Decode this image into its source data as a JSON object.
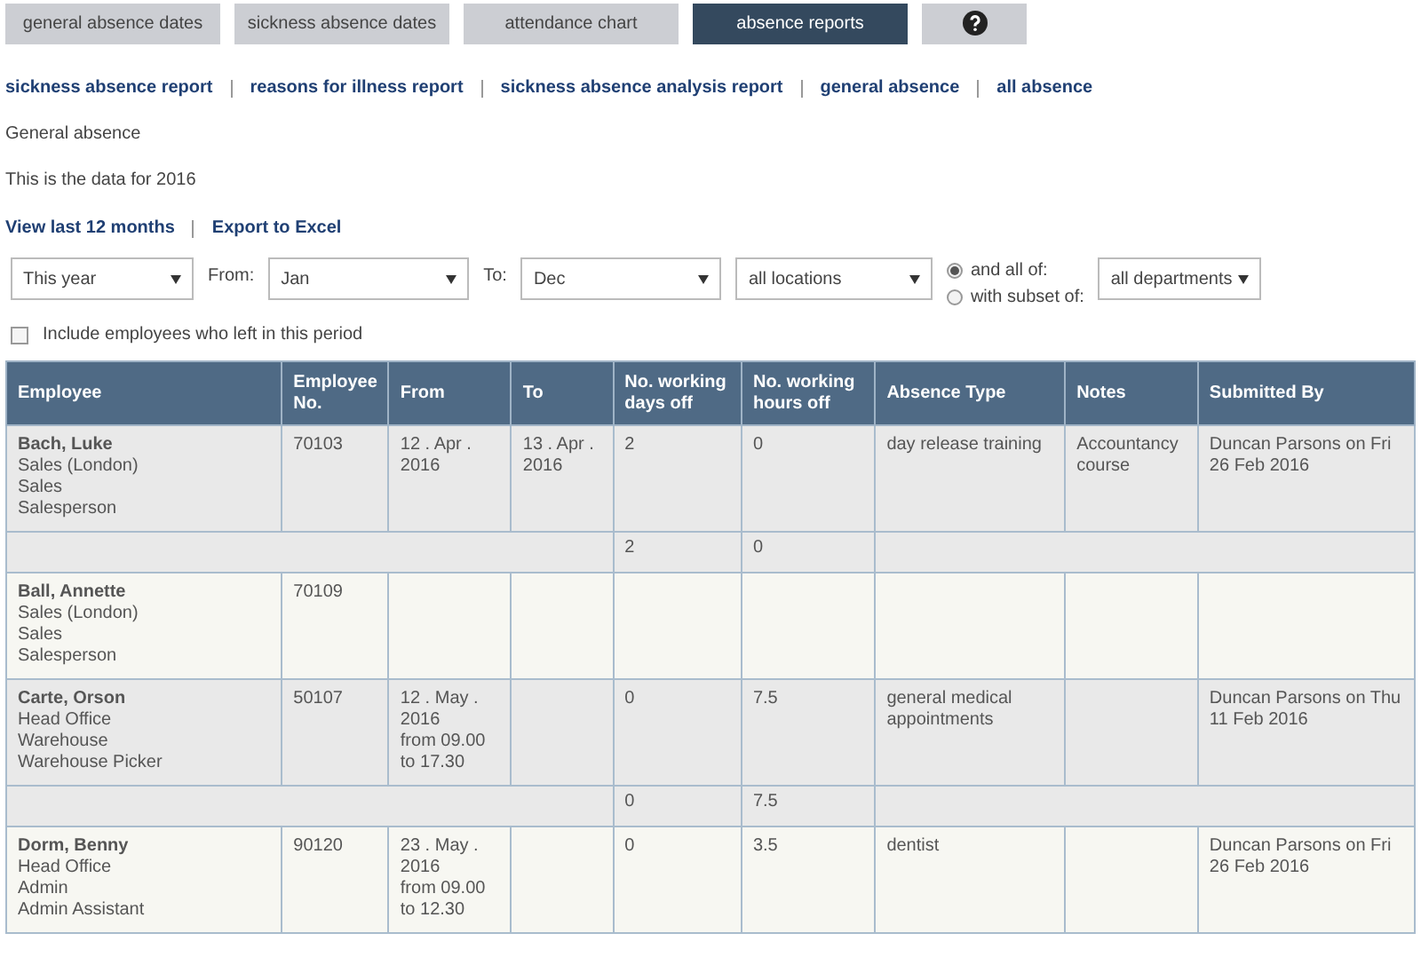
{
  "tabs": [
    {
      "kind": "text",
      "label": "general absence dates",
      "selected": false
    },
    {
      "kind": "text",
      "label": "sickness absence dates",
      "selected": false
    },
    {
      "kind": "text",
      "label": "attendance chart",
      "selected": false
    },
    {
      "kind": "text",
      "label": "absence reports",
      "selected": true
    },
    {
      "kind": "help",
      "selected": false
    }
  ],
  "report_links": [
    "sickness absence report",
    "reasons for illness report",
    "sickness absence analysis report",
    "general absence",
    "all absence"
  ],
  "report_title": "General absence",
  "subtitle": "This is the data for 2016",
  "actions": [
    "View last 12 months",
    "Export to Excel"
  ],
  "filters": {
    "period": "This year",
    "from_label": "From:",
    "from": "Jan",
    "to_label": "To:",
    "to": "Dec",
    "location": "all locations",
    "radios": [
      {
        "label": "and all of:",
        "selected": true
      },
      {
        "label": "with subset of:",
        "selected": false
      }
    ],
    "department": "all departments",
    "leavers": {
      "label": "Include employees who left in this period",
      "checked": false
    }
  },
  "table": {
    "columns": [
      "Employee",
      "Employee No.",
      "From",
      "To",
      "No. working days off",
      "No. working hours off",
      "Absence Type",
      "Notes",
      "Submitted By"
    ],
    "rows": [
      {
        "kind": "employee",
        "name": "Bach, Luke",
        "details": [
          "Sales (London)",
          "Sales",
          "Salesperson"
        ],
        "employee_no": "70103",
        "from": [
          "12 . Apr .",
          "2016"
        ],
        "to": [
          "13 . Apr .",
          "2016"
        ],
        "days": "2",
        "hours": "0",
        "absence_type": "day release training",
        "notes": "Accountancy course",
        "submitted_by": "Duncan Parsons on Fri 26 Feb 2016"
      },
      {
        "kind": "subtotal",
        "days": "2",
        "hours": "0"
      },
      {
        "kind": "employee",
        "name": "Ball, Annette",
        "details": [
          "Sales (London)",
          "Sales",
          "Salesperson"
        ],
        "employee_no": "70109"
      },
      {
        "kind": "employee",
        "name": "Carte, Orson",
        "details": [
          "Head Office",
          "Warehouse",
          "Warehouse Picker"
        ],
        "employee_no": "50107",
        "from": [
          "12 . May .",
          "2016",
          "from 09.00",
          "to 17.30"
        ],
        "days": "0",
        "hours": "7.5",
        "absence_type": "general medical appointments",
        "submitted_by": "Duncan Parsons on Thu 11 Feb 2016"
      },
      {
        "kind": "subtotal",
        "days": "0",
        "hours": "7.5"
      },
      {
        "kind": "employee",
        "name": "Dorm, Benny",
        "details": [
          "Head Office",
          "Admin",
          "Admin Assistant"
        ],
        "employee_no": "90120",
        "from": [
          "23 . May .",
          "2016",
          "from 09.00",
          "to 12.30"
        ],
        "days": "0",
        "hours": "3.5",
        "absence_type": "dentist",
        "submitted_by": "Duncan Parsons on Fri 26 Feb 2016"
      }
    ]
  }
}
